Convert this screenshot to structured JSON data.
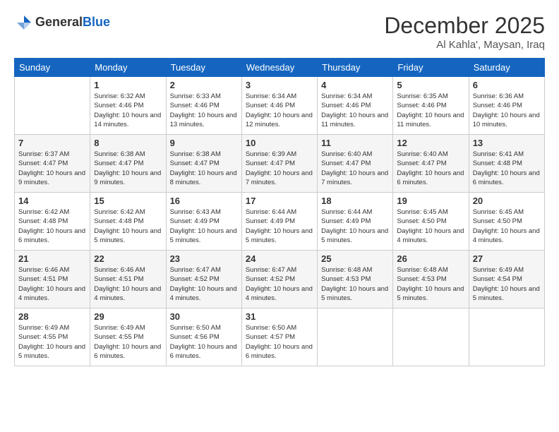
{
  "header": {
    "logo_line1": "General",
    "logo_line2": "Blue",
    "month": "December 2025",
    "location": "Al Kahla', Maysan, Iraq"
  },
  "weekdays": [
    "Sunday",
    "Monday",
    "Tuesday",
    "Wednesday",
    "Thursday",
    "Friday",
    "Saturday"
  ],
  "weeks": [
    [
      {
        "day": "",
        "sunrise": "",
        "sunset": "",
        "daylight": ""
      },
      {
        "day": "1",
        "sunrise": "Sunrise: 6:32 AM",
        "sunset": "Sunset: 4:46 PM",
        "daylight": "Daylight: 10 hours and 14 minutes."
      },
      {
        "day": "2",
        "sunrise": "Sunrise: 6:33 AM",
        "sunset": "Sunset: 4:46 PM",
        "daylight": "Daylight: 10 hours and 13 minutes."
      },
      {
        "day": "3",
        "sunrise": "Sunrise: 6:34 AM",
        "sunset": "Sunset: 4:46 PM",
        "daylight": "Daylight: 10 hours and 12 minutes."
      },
      {
        "day": "4",
        "sunrise": "Sunrise: 6:34 AM",
        "sunset": "Sunset: 4:46 PM",
        "daylight": "Daylight: 10 hours and 11 minutes."
      },
      {
        "day": "5",
        "sunrise": "Sunrise: 6:35 AM",
        "sunset": "Sunset: 4:46 PM",
        "daylight": "Daylight: 10 hours and 11 minutes."
      },
      {
        "day": "6",
        "sunrise": "Sunrise: 6:36 AM",
        "sunset": "Sunset: 4:46 PM",
        "daylight": "Daylight: 10 hours and 10 minutes."
      }
    ],
    [
      {
        "day": "7",
        "sunrise": "Sunrise: 6:37 AM",
        "sunset": "Sunset: 4:47 PM",
        "daylight": "Daylight: 10 hours and 9 minutes."
      },
      {
        "day": "8",
        "sunrise": "Sunrise: 6:38 AM",
        "sunset": "Sunset: 4:47 PM",
        "daylight": "Daylight: 10 hours and 9 minutes."
      },
      {
        "day": "9",
        "sunrise": "Sunrise: 6:38 AM",
        "sunset": "Sunset: 4:47 PM",
        "daylight": "Daylight: 10 hours and 8 minutes."
      },
      {
        "day": "10",
        "sunrise": "Sunrise: 6:39 AM",
        "sunset": "Sunset: 4:47 PM",
        "daylight": "Daylight: 10 hours and 7 minutes."
      },
      {
        "day": "11",
        "sunrise": "Sunrise: 6:40 AM",
        "sunset": "Sunset: 4:47 PM",
        "daylight": "Daylight: 10 hours and 7 minutes."
      },
      {
        "day": "12",
        "sunrise": "Sunrise: 6:40 AM",
        "sunset": "Sunset: 4:47 PM",
        "daylight": "Daylight: 10 hours and 6 minutes."
      },
      {
        "day": "13",
        "sunrise": "Sunrise: 6:41 AM",
        "sunset": "Sunset: 4:48 PM",
        "daylight": "Daylight: 10 hours and 6 minutes."
      }
    ],
    [
      {
        "day": "14",
        "sunrise": "Sunrise: 6:42 AM",
        "sunset": "Sunset: 4:48 PM",
        "daylight": "Daylight: 10 hours and 6 minutes."
      },
      {
        "day": "15",
        "sunrise": "Sunrise: 6:42 AM",
        "sunset": "Sunset: 4:48 PM",
        "daylight": "Daylight: 10 hours and 5 minutes."
      },
      {
        "day": "16",
        "sunrise": "Sunrise: 6:43 AM",
        "sunset": "Sunset: 4:49 PM",
        "daylight": "Daylight: 10 hours and 5 minutes."
      },
      {
        "day": "17",
        "sunrise": "Sunrise: 6:44 AM",
        "sunset": "Sunset: 4:49 PM",
        "daylight": "Daylight: 10 hours and 5 minutes."
      },
      {
        "day": "18",
        "sunrise": "Sunrise: 6:44 AM",
        "sunset": "Sunset: 4:49 PM",
        "daylight": "Daylight: 10 hours and 5 minutes."
      },
      {
        "day": "19",
        "sunrise": "Sunrise: 6:45 AM",
        "sunset": "Sunset: 4:50 PM",
        "daylight": "Daylight: 10 hours and 4 minutes."
      },
      {
        "day": "20",
        "sunrise": "Sunrise: 6:45 AM",
        "sunset": "Sunset: 4:50 PM",
        "daylight": "Daylight: 10 hours and 4 minutes."
      }
    ],
    [
      {
        "day": "21",
        "sunrise": "Sunrise: 6:46 AM",
        "sunset": "Sunset: 4:51 PM",
        "daylight": "Daylight: 10 hours and 4 minutes."
      },
      {
        "day": "22",
        "sunrise": "Sunrise: 6:46 AM",
        "sunset": "Sunset: 4:51 PM",
        "daylight": "Daylight: 10 hours and 4 minutes."
      },
      {
        "day": "23",
        "sunrise": "Sunrise: 6:47 AM",
        "sunset": "Sunset: 4:52 PM",
        "daylight": "Daylight: 10 hours and 4 minutes."
      },
      {
        "day": "24",
        "sunrise": "Sunrise: 6:47 AM",
        "sunset": "Sunset: 4:52 PM",
        "daylight": "Daylight: 10 hours and 4 minutes."
      },
      {
        "day": "25",
        "sunrise": "Sunrise: 6:48 AM",
        "sunset": "Sunset: 4:53 PM",
        "daylight": "Daylight: 10 hours and 5 minutes."
      },
      {
        "day": "26",
        "sunrise": "Sunrise: 6:48 AM",
        "sunset": "Sunset: 4:53 PM",
        "daylight": "Daylight: 10 hours and 5 minutes."
      },
      {
        "day": "27",
        "sunrise": "Sunrise: 6:49 AM",
        "sunset": "Sunset: 4:54 PM",
        "daylight": "Daylight: 10 hours and 5 minutes."
      }
    ],
    [
      {
        "day": "28",
        "sunrise": "Sunrise: 6:49 AM",
        "sunset": "Sunset: 4:55 PM",
        "daylight": "Daylight: 10 hours and 5 minutes."
      },
      {
        "day": "29",
        "sunrise": "Sunrise: 6:49 AM",
        "sunset": "Sunset: 4:55 PM",
        "daylight": "Daylight: 10 hours and 6 minutes."
      },
      {
        "day": "30",
        "sunrise": "Sunrise: 6:50 AM",
        "sunset": "Sunset: 4:56 PM",
        "daylight": "Daylight: 10 hours and 6 minutes."
      },
      {
        "day": "31",
        "sunrise": "Sunrise: 6:50 AM",
        "sunset": "Sunset: 4:57 PM",
        "daylight": "Daylight: 10 hours and 6 minutes."
      },
      {
        "day": "",
        "sunrise": "",
        "sunset": "",
        "daylight": ""
      },
      {
        "day": "",
        "sunrise": "",
        "sunset": "",
        "daylight": ""
      },
      {
        "day": "",
        "sunrise": "",
        "sunset": "",
        "daylight": ""
      }
    ]
  ]
}
